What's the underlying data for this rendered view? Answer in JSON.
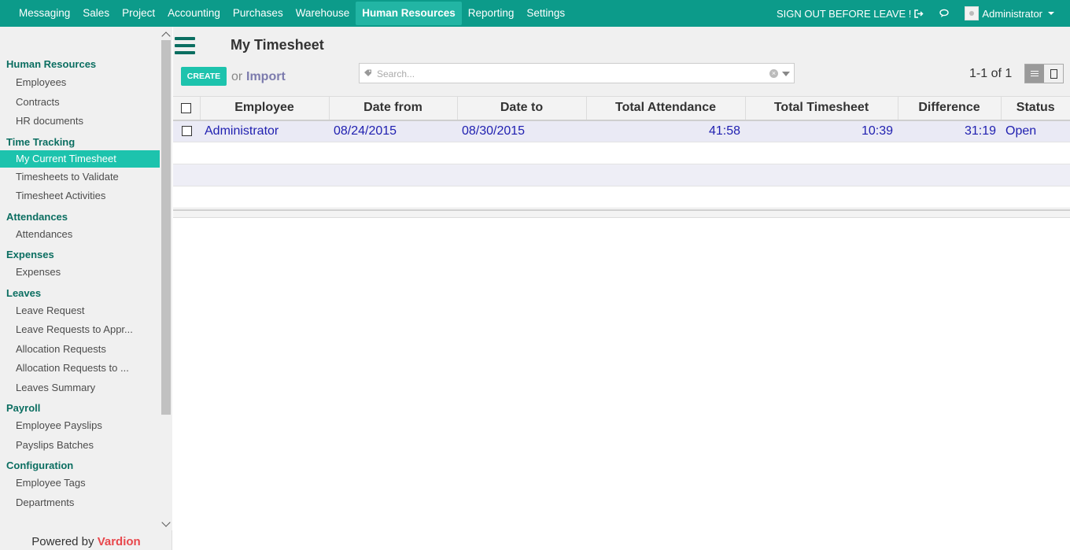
{
  "topbar": {
    "menu": [
      "Messaging",
      "Sales",
      "Project",
      "Accounting",
      "Purchases",
      "Warehouse",
      "Human Resources",
      "Reporting",
      "Settings"
    ],
    "active_menu": "Human Resources",
    "signout_label": "SIGN OUT BEFORE LEAVE !",
    "user_name": "Administrator"
  },
  "sidebar": {
    "sections": [
      {
        "title": "Human Resources",
        "items": [
          "Employees",
          "Contracts",
          "HR documents"
        ]
      },
      {
        "title": "Time Tracking",
        "items": [
          "My Current Timesheet",
          "Timesheets to Validate",
          "Timesheet Activities"
        ]
      },
      {
        "title": "Attendances",
        "items": [
          "Attendances"
        ]
      },
      {
        "title": "Expenses",
        "items": [
          "Expenses"
        ]
      },
      {
        "title": "Leaves",
        "items": [
          "Leave Request",
          "Leave Requests to Appr...",
          "Allocation Requests",
          "Allocation Requests to ...",
          "Leaves Summary"
        ]
      },
      {
        "title": "Payroll",
        "items": [
          "Employee Payslips",
          "Payslips Batches"
        ]
      },
      {
        "title": "Configuration",
        "items": [
          "Employee Tags",
          "Departments"
        ]
      }
    ],
    "active_item": "My Current Timesheet",
    "powered_by": "Powered by",
    "powered_brand": "Vardion"
  },
  "control": {
    "title": "My Timesheet",
    "create_label": "CREATE",
    "or_label": "or",
    "import_label": "Import",
    "search_placeholder": "Search...",
    "pager": "1-1 of 1"
  },
  "table": {
    "columns": [
      "Employee",
      "Date from",
      "Date to",
      "Total Attendance",
      "Total Timesheet",
      "Difference",
      "Status"
    ],
    "rows": [
      {
        "employee": "Administrator",
        "date_from": "08/24/2015",
        "date_to": "08/30/2015",
        "total_attendance": "41:58",
        "total_timesheet": "10:39",
        "difference": "31:19",
        "status": "Open"
      }
    ]
  },
  "colors": {
    "topbar": "#0c9b8a",
    "accent": "#1dc3ad",
    "section": "#0b6e61",
    "link": "#1f1fb0",
    "brand": "#e8474c"
  }
}
